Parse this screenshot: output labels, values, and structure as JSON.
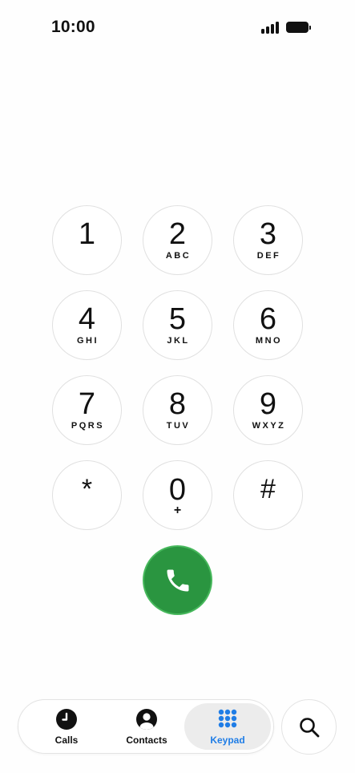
{
  "status_bar": {
    "time": "10:00",
    "signal_icon": "cellular-signal-icon",
    "battery_icon": "battery-full-icon"
  },
  "keypad": {
    "keys": [
      {
        "digit": "1",
        "letters": ""
      },
      {
        "digit": "2",
        "letters": "ABC"
      },
      {
        "digit": "3",
        "letters": "DEF"
      },
      {
        "digit": "4",
        "letters": "GHI"
      },
      {
        "digit": "5",
        "letters": "JKL"
      },
      {
        "digit": "6",
        "letters": "MNO"
      },
      {
        "digit": "7",
        "letters": "PQRS"
      },
      {
        "digit": "8",
        "letters": "TUV"
      },
      {
        "digit": "9",
        "letters": "WXYZ"
      },
      {
        "digit": "*",
        "letters": ""
      },
      {
        "digit": "0",
        "letters": "+"
      },
      {
        "digit": "#",
        "letters": ""
      }
    ]
  },
  "call_button": {
    "icon": "phone-icon",
    "color": "#2a9540"
  },
  "tabbar": {
    "active": "keypad",
    "accent_color": "#1f7de6",
    "tabs": [
      {
        "id": "calls",
        "label": "Calls",
        "icon": "clock-icon"
      },
      {
        "id": "contacts",
        "label": "Contacts",
        "icon": "person-circle-icon"
      },
      {
        "id": "keypad",
        "label": "Keypad",
        "icon": "keypad-grid-icon"
      }
    ]
  },
  "search_button": {
    "icon": "search-icon"
  }
}
